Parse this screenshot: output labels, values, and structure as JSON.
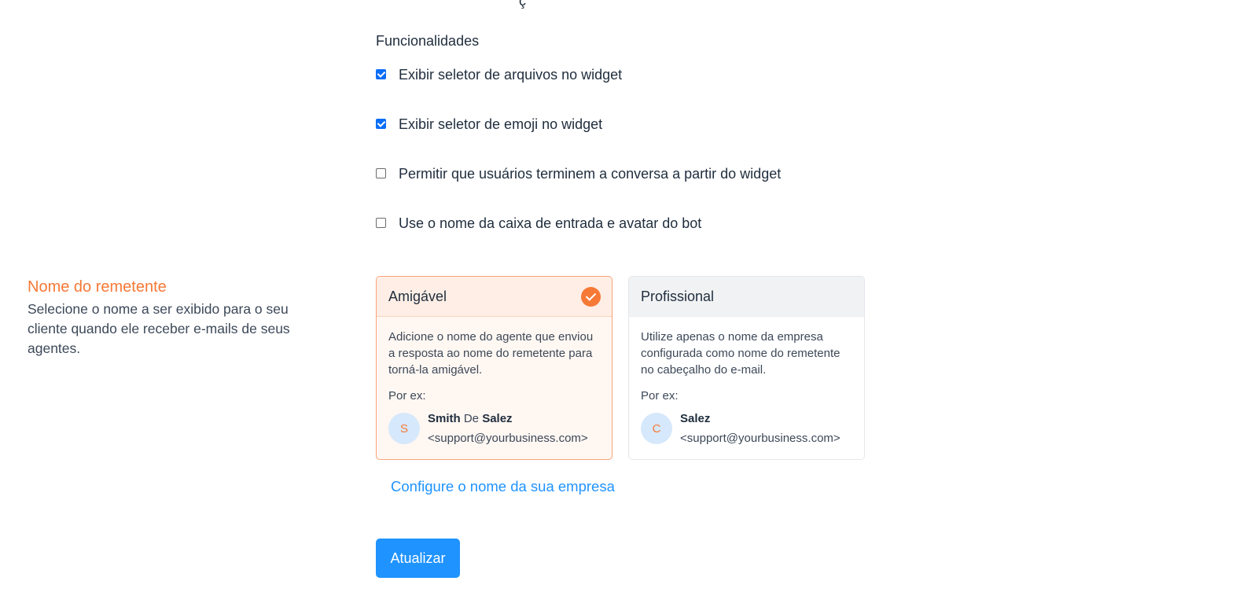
{
  "features": {
    "title": "Funcionalidades",
    "options": [
      {
        "label": "Exibir seletor de arquivos no widget",
        "checked": true
      },
      {
        "label": "Exibir seletor de emoji no widget",
        "checked": true
      },
      {
        "label": "Permitir que usuários terminem a conversa a partir do widget",
        "checked": false
      },
      {
        "label": "Use o nome da caixa de entrada e avatar do bot",
        "checked": false
      }
    ]
  },
  "sender_name": {
    "title": "Nome do remetente",
    "description": "Selecione o nome a ser exibido para o seu cliente quando ele receber e-mails de seus agentes.",
    "cards": {
      "friendly": {
        "title": "Amigável",
        "selected": true,
        "text": "Adicione o nome do agente que enviou a resposta ao nome do remetente para torná-la amigável.",
        "example_label": "Por ex:",
        "avatar_letter": "S",
        "name_first": "Smith",
        "name_mid": "De",
        "name_last": "Salez",
        "email": "<support@yourbusiness.com>"
      },
      "professional": {
        "title": "Profissional",
        "selected": false,
        "text": "Utilize apenas o nome da empresa configurada como nome do remetente no cabeçalho do e-mail.",
        "example_label": "Por ex:",
        "avatar_letter": "C",
        "name": "Salez",
        "email": "<support@yourbusiness.com>"
      }
    },
    "configure_link": "Configure o nome da sua empresa"
  },
  "actions": {
    "update_label": "Atualizar"
  },
  "colors": {
    "accent": "#f67936",
    "primary": "#1f93ff",
    "checkbox": "#0b6ef7"
  }
}
